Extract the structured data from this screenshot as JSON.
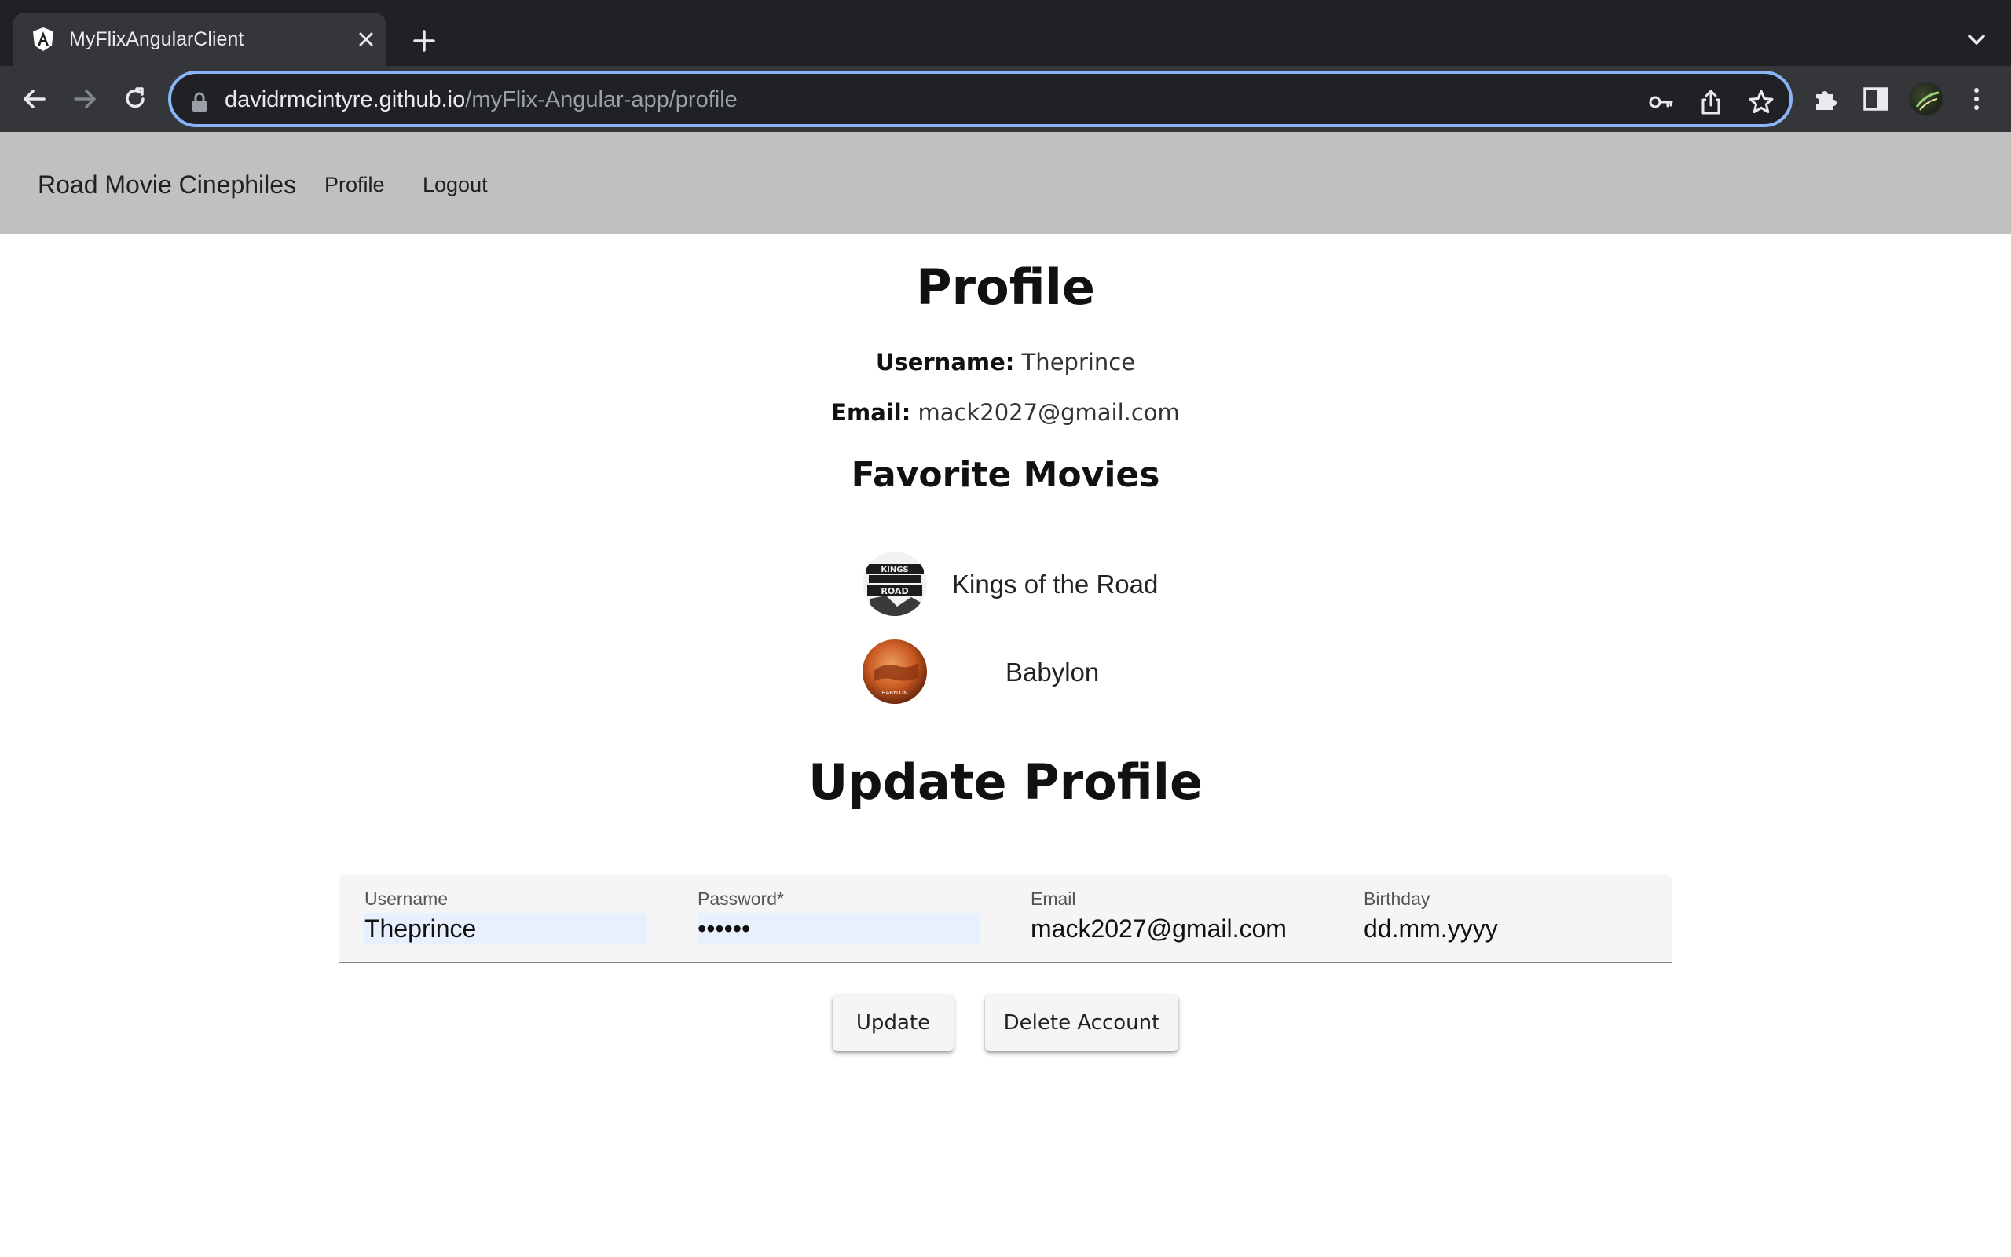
{
  "browser": {
    "tab_title": "MyFlixAngularClient",
    "url_host": "davidrmcintyre.github.io",
    "url_path": "/myFlix-Angular-app/profile"
  },
  "navbar": {
    "brand": "Road Movie Cinephiles",
    "links": [
      "Profile",
      "Logout"
    ]
  },
  "profile": {
    "title": "Profile",
    "username_label": "Username:",
    "username": "Theprince",
    "email_label": "Email:",
    "email": "mack2027@gmail.com"
  },
  "favorites": {
    "title": "Favorite Movies",
    "movies": [
      {
        "title": "Kings of the Road",
        "thumb_caption": "KINGS OF THE ROAD"
      },
      {
        "title": "Babylon",
        "thumb_caption": "BABYLON"
      }
    ]
  },
  "update": {
    "title": "Update Profile",
    "fields": [
      {
        "label": "Username",
        "value": "Theprince"
      },
      {
        "label": "Password*",
        "value": "••••••"
      },
      {
        "label": "Email",
        "value": "mack2027@gmail.com"
      },
      {
        "label": "Birthday",
        "value": "dd.mm.yyyy"
      }
    ],
    "update_label": "Update",
    "delete_label": "Delete Account"
  },
  "colors": {
    "navbar_bg": "#c0c0c0",
    "chrome_dark": "#202124",
    "omnibox_focus": "#8ab4f8"
  }
}
